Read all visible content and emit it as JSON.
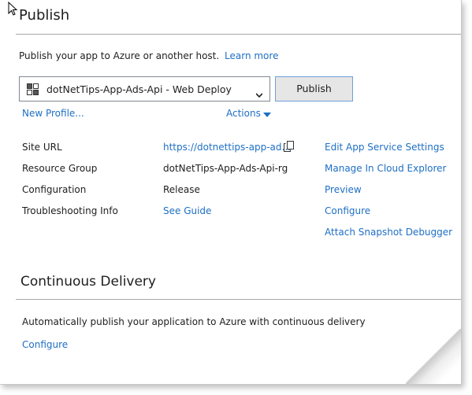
{
  "publish": {
    "title": "Publish",
    "description": "Publish your app to Azure or another host.",
    "learn_more": "Learn more",
    "profile_selected": "dotNetTips-App-Ads-Api - Web Deploy",
    "publish_button": "Publish",
    "new_profile": "New Profile...",
    "actions": "Actions"
  },
  "summary": {
    "rows": [
      {
        "label": "Site URL",
        "value": "https://dotnettips-app-ad..."
      },
      {
        "label": "Resource Group",
        "value": "dotNetTips-App-Ads-Api-rg"
      },
      {
        "label": "Configuration",
        "value": "Release"
      },
      {
        "label": "Troubleshooting Info",
        "value": "See Guide"
      }
    ],
    "actions": [
      "Edit App Service Settings",
      "Manage In Cloud Explorer",
      "Preview",
      "Configure",
      "Attach Snapshot Debugger"
    ]
  },
  "continuous_delivery": {
    "title": "Continuous Delivery",
    "description": "Automatically publish your application to Azure with continuous delivery",
    "configure": "Configure"
  },
  "colors": {
    "link": "#1e6fc4",
    "button_border": "#6f9fd8"
  },
  "icons": [
    "cursor-icon",
    "web-deploy-icon",
    "chevron-down-icon",
    "copy-icon",
    "caret-down-icon"
  ]
}
